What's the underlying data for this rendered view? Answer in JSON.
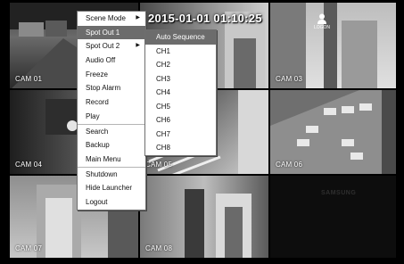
{
  "overlay": {
    "datetime": "2015-01-01 01:10:25",
    "user_label": "LOGON",
    "brand": "SAMSUNG"
  },
  "cameras": [
    "CAM 01",
    "",
    "CAM 03",
    "CAM 04",
    "CAM 05",
    "CAM 06",
    "CAM 07",
    "CAM 08",
    ""
  ],
  "menu": {
    "items": [
      {
        "label": "Scene Mode",
        "arrow": "▶"
      },
      {
        "label": "Spot Out 1",
        "arrow": ""
      },
      {
        "label": "Spot Out 2",
        "arrow": "▶"
      },
      {
        "label": "Audio Off",
        "arrow": ""
      },
      {
        "label": "Freeze",
        "arrow": ""
      },
      {
        "label": "Stop Alarm",
        "arrow": ""
      },
      {
        "label": "Record",
        "arrow": ""
      },
      {
        "label": "Play",
        "arrow": ""
      },
      {
        "label": "Search",
        "arrow": ""
      },
      {
        "label": "Backup",
        "arrow": ""
      },
      {
        "label": "Main Menu",
        "arrow": ""
      },
      {
        "label": "Shutdown",
        "arrow": ""
      },
      {
        "label": "Hide Launcher",
        "arrow": ""
      },
      {
        "label": "Logout",
        "arrow": ""
      }
    ]
  },
  "submenu": {
    "items": [
      "Auto Sequence",
      "CH1",
      "CH2",
      "CH3",
      "CH4",
      "CH5",
      "CH6",
      "CH7",
      "CH8"
    ]
  }
}
